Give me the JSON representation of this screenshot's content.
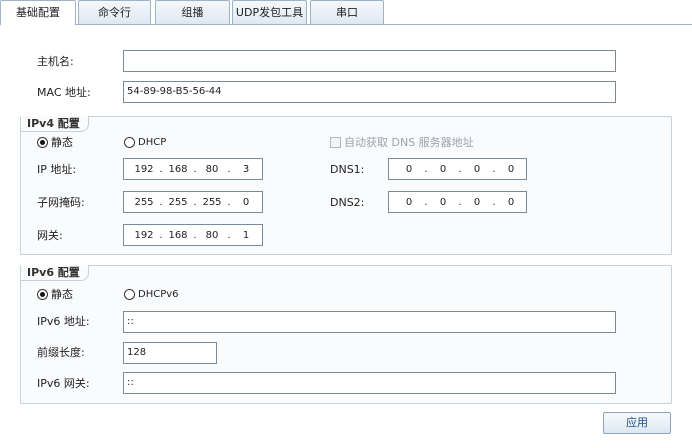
{
  "tabs": [
    {
      "label": "基础配置",
      "active": true
    },
    {
      "label": "命令行",
      "active": false
    },
    {
      "label": "组播",
      "active": false
    },
    {
      "label": "UDP发包工具",
      "active": false
    },
    {
      "label": "串口",
      "active": false
    }
  ],
  "basic": {
    "hostname_label": "主机名:",
    "hostname_value": "",
    "mac_label": "MAC 地址:",
    "mac_value": "54-89-98-B5-56-44"
  },
  "ipv4": {
    "title": "IPv4 配置",
    "static_label": "静态",
    "static_checked": true,
    "dhcp_label": "DHCP",
    "dhcp_checked": false,
    "auto_dns_label": "自动获取 DNS 服务器地址",
    "ip_label": "IP 地址:",
    "ip": [
      "192",
      "168",
      "80",
      "3"
    ],
    "mask_label": "子网掩码:",
    "mask": [
      "255",
      "255",
      "255",
      "0"
    ],
    "gateway_label": "网关:",
    "gateway": [
      "192",
      "168",
      "80",
      "1"
    ],
    "dns1_label": "DNS1:",
    "dns1": [
      "0",
      "0",
      "0",
      "0"
    ],
    "dns2_label": "DNS2:",
    "dns2": [
      "0",
      "0",
      "0",
      "0"
    ],
    "dot": "."
  },
  "ipv6": {
    "title": "IPv6 配置",
    "static_label": "静态",
    "static_checked": true,
    "dhcpv6_label": "DHCPv6",
    "dhcpv6_checked": false,
    "addr_label": "IPv6 地址:",
    "addr_value": "::",
    "prefix_label": "前缀长度:",
    "prefix_value": "128",
    "gateway_label": "IPv6 网关:",
    "gateway_value": "::"
  },
  "apply_label": "应用"
}
